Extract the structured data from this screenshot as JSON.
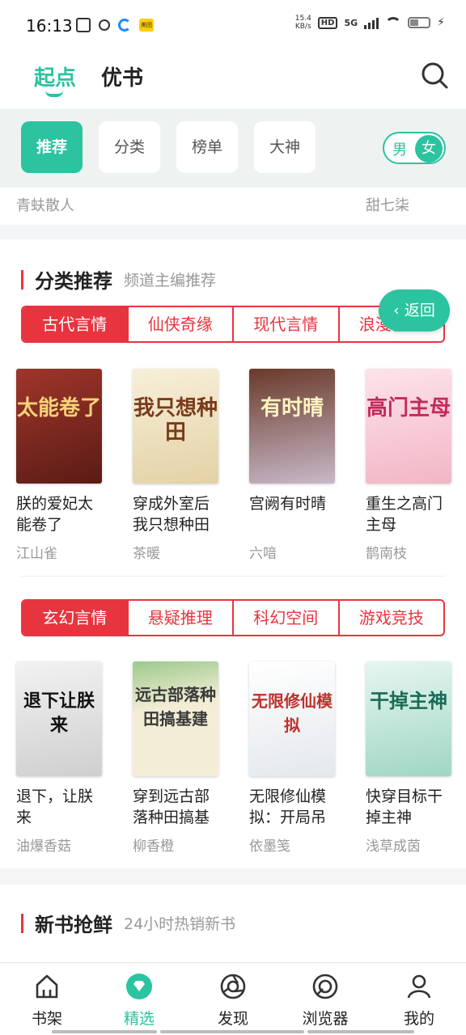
{
  "status_bar": {
    "time": "16:13",
    "speed": "15.4",
    "speed_unit": "KB/s",
    "hd": "HD",
    "network": "5G",
    "yellow_app": "美团"
  },
  "header": {
    "tab_qidian": "起点",
    "tab_youshu": "优书"
  },
  "chips": {
    "recommend": "推荐",
    "category": "分类",
    "ranking": "榜单",
    "masters": "大神"
  },
  "gender": {
    "male": "男",
    "female": "女"
  },
  "prev_row": {
    "author_1": "青蚨散人",
    "author_4": "甜七柒"
  },
  "category_section": {
    "title": "分类推荐",
    "subtitle": "频道主编推荐",
    "tabs_1": [
      "古代言情",
      "仙侠奇缘",
      "现代言情",
      "浪漫青春"
    ],
    "tabs_2": [
      "玄幻言情",
      "悬疑推理",
      "科幻空间",
      "游戏竞技"
    ],
    "books_1": [
      {
        "title": "朕的爱妃太能卷了",
        "author": "江山雀",
        "cover_text": "太能卷了"
      },
      {
        "title": "穿成外室后我只想种田",
        "author": "茶暖",
        "cover_text": "我只想种田"
      },
      {
        "title": "宫阙有时晴",
        "author": "六喑",
        "cover_text": "有时晴"
      },
      {
        "title": "重生之高门主母",
        "author": "鹊南枝",
        "cover_text": "高门主母"
      }
    ],
    "books_2": [
      {
        "title": "退下，让朕来",
        "author": "油爆香菇",
        "cover_text": "退下让朕来"
      },
      {
        "title": "穿到远古部落种田搞基建",
        "author": "柳香橙",
        "cover_text": "远古部落种田搞基建"
      },
      {
        "title": "无限修仙模拟：开局吊",
        "author": "依墨笺",
        "cover_text": "无限修仙模拟"
      },
      {
        "title": "快穿目标干掉主神",
        "author": "浅草成茵",
        "cover_text": "干掉主神"
      }
    ]
  },
  "back_button": {
    "label": "返回"
  },
  "new_section": {
    "title": "新书抢鲜",
    "subtitle": "24小时热销新书"
  },
  "bottom_nav": {
    "shelf": "书架",
    "featured": "精选",
    "discover": "发现",
    "browser": "浏览器",
    "mine": "我的"
  },
  "colors": {
    "accent": "#2bc3a0",
    "red": "#e8343f"
  }
}
